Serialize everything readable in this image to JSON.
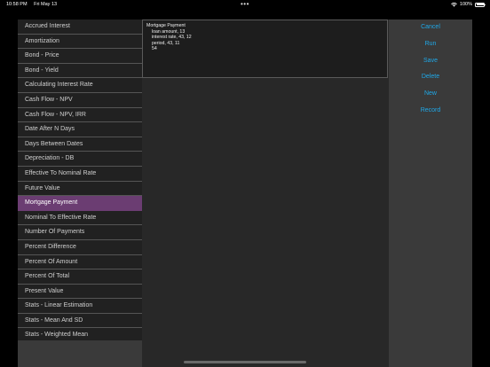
{
  "status_bar": {
    "time": "10:58 PM",
    "date": "Fri May 13",
    "dots": "•••",
    "battery": "100%"
  },
  "sidebar": {
    "items": [
      {
        "label": "Accrued Interest"
      },
      {
        "label": "Amortization"
      },
      {
        "label": "Bond - Price"
      },
      {
        "label": "Bond - Yield"
      },
      {
        "label": "Calculating Interest Rate"
      },
      {
        "label": "Cash Flow - NPV"
      },
      {
        "label": "Cash Flow - NPV, IRR"
      },
      {
        "label": "Date After N Days"
      },
      {
        "label": "Days Between Dates"
      },
      {
        "label": "Depreciation - DB"
      },
      {
        "label": "Effective To Nominal Rate"
      },
      {
        "label": "Future Value"
      },
      {
        "label": "Mortgage Payment",
        "selected": true
      },
      {
        "label": "Nominal To Effective Rate"
      },
      {
        "label": "Number Of Payments"
      },
      {
        "label": "Percent Difference"
      },
      {
        "label": "Percent Of Amount"
      },
      {
        "label": "Percent Of Total"
      },
      {
        "label": "Present Value"
      },
      {
        "label": "Stats - Linear Estimation"
      },
      {
        "label": "Stats - Mean And SD"
      },
      {
        "label": "Stats - Weighted Mean"
      }
    ]
  },
  "output": {
    "title": "Mortgage Payment",
    "lines": [
      "loan amount, 13",
      "interest rate, 43, 12",
      "period, 43, 11",
      "54"
    ]
  },
  "actions": {
    "cancel": "Cancel",
    "run": "Run",
    "save": "Save",
    "delete": "Delete",
    "new": "New",
    "record": "Record"
  },
  "colors": {
    "accent": "#1fa8e8",
    "selected": "#6b3d72"
  }
}
